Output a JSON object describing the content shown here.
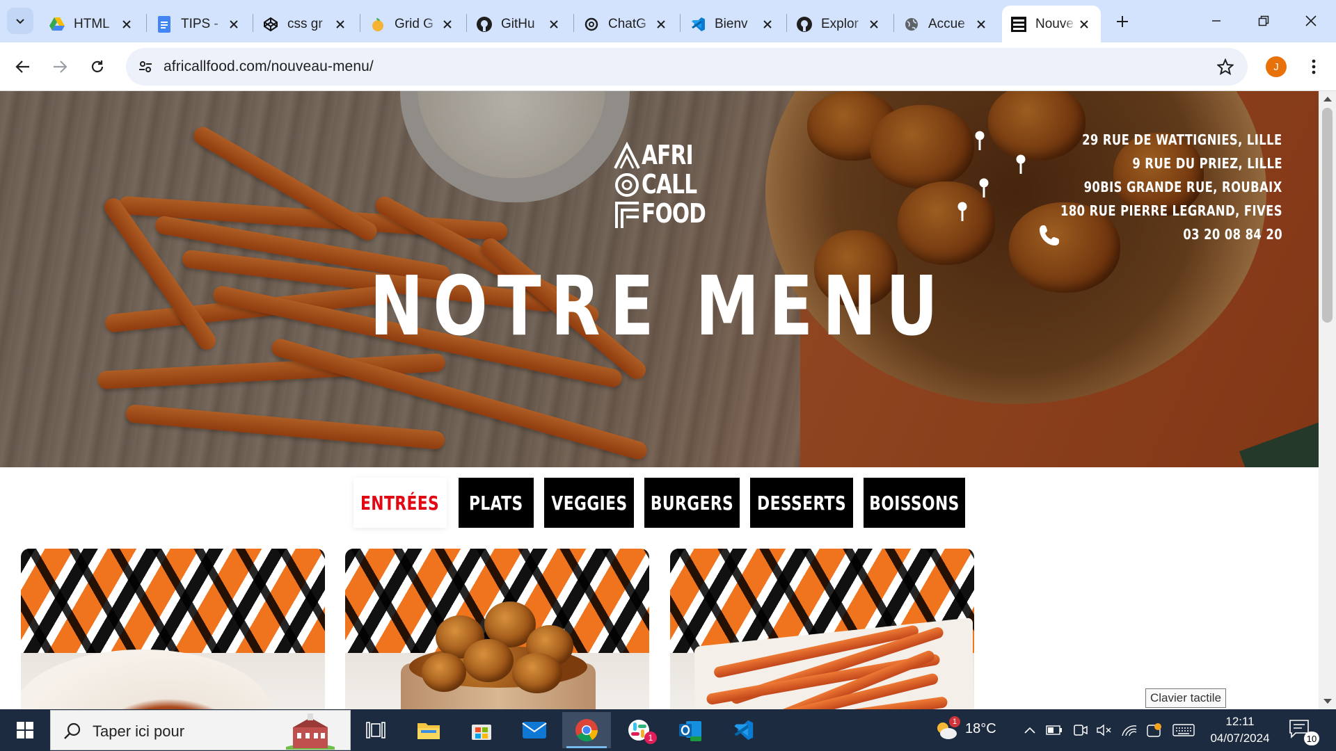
{
  "browser": {
    "tabs": [
      {
        "title": "HTML",
        "icon": "google-drive-icon"
      },
      {
        "title": "TIPS -",
        "icon": "google-docs-icon"
      },
      {
        "title": "css gr",
        "icon": "codepen-icon"
      },
      {
        "title": "Grid G",
        "icon": "grid-generator-icon"
      },
      {
        "title": "GitHu",
        "icon": "github-icon"
      },
      {
        "title": "ChatG",
        "icon": "chatgpt-icon"
      },
      {
        "title": "Bienv",
        "icon": "vscode-icon"
      },
      {
        "title": "Explor",
        "icon": "github-icon"
      },
      {
        "title": "Accue",
        "icon": "globe-icon"
      },
      {
        "title": "Nouve",
        "icon": "africallfood-icon"
      }
    ],
    "active_tab_index": 9,
    "url": "africallfood.com/nouveau-menu/",
    "profile_initial": "J"
  },
  "page": {
    "logo": {
      "line1": "AFRI",
      "line2": "CALL",
      "line3": "FOOD"
    },
    "title": "NOTRE MENU",
    "addresses": [
      "29 RUE DE WATTIGNIES, LILLE",
      "9 RUE DU PRIEZ, LILLE",
      "90BIS GRANDE RUE, ROUBAIX",
      "180 RUE PIERRE LEGRAND, FIVES"
    ],
    "phone": "03 20 08 84 20",
    "categories": [
      "ENTRÉES",
      "PLATS",
      "VEGGIES",
      "BURGERS",
      "DESSERTS",
      "BOISSONS"
    ],
    "active_category_index": 0,
    "colors": {
      "accent": "#e30613",
      "category_bg": "#000000",
      "pattern_orange": "#f0741d"
    },
    "cards": [
      {
        "image": "wrap-image"
      },
      {
        "image": "plantain-cup-image"
      },
      {
        "image": "sweet-potato-fries-image"
      }
    ]
  },
  "tooltip": "Clavier tactile",
  "taskbar": {
    "search_placeholder": "Taper ici pour",
    "apps": [
      "task-view-icon",
      "file-explorer-icon",
      "microsoft-store-icon",
      "mail-icon",
      "chrome-icon",
      "slack-icon",
      "outlook-icon",
      "vscode-icon"
    ],
    "active_app_index": 4,
    "slack_badge": "1",
    "weather_temp": "18°C",
    "weather_badge": "1",
    "time": "12:11",
    "date": "04/07/2024",
    "notifications": "10"
  }
}
